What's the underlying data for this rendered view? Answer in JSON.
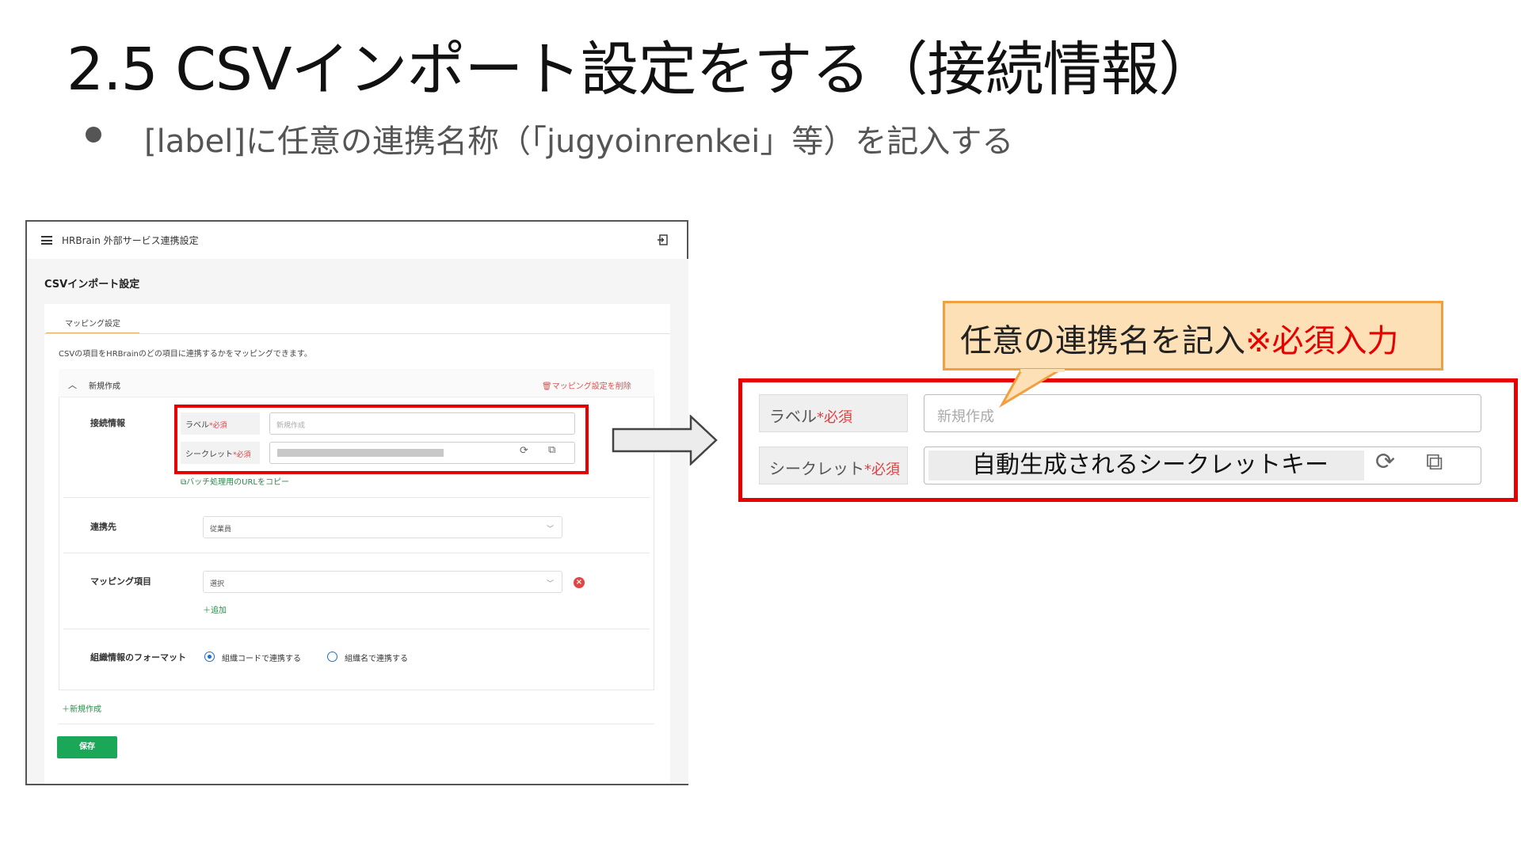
{
  "slide": {
    "title": "2.5 CSVインポート設定をする（接続情報）",
    "bullet": "[label]に任意の連携名称（「jugyoinrenkei」等）を記入する"
  },
  "app": {
    "title": "HRBrain 外部サービス連携設定",
    "page_heading": "CSVインポート設定",
    "tab": "マッピング設定",
    "description": "CSVの項目をHRBrainのどの項目に連携するかをマッピングできます。",
    "section_title": "新規作成",
    "delete_link": "マッピング設定を削除",
    "connection_label": "接続情報",
    "label_field": "ラベル",
    "required": "*必須",
    "label_placeholder": "新規作成",
    "secret_field": "シークレット",
    "copy_url_link": "バッチ処理用のURLをコピー",
    "destination_label": "連携先",
    "destination_value": "従業員",
    "mapping_label": "マッピング項目",
    "mapping_value": "選択",
    "add_label": "追加",
    "format_label": "組織情報のフォーマット",
    "radio_code": "組織コードで連携する",
    "radio_name": "組織名で連携する",
    "new_link": "新規作成",
    "save": "保存"
  },
  "zoom": {
    "label_field": "ラベル",
    "secret_field": "シークレット",
    "required": "*必須",
    "label_placeholder": "新規作成",
    "secret_value": "自動生成されるシークレットキー"
  },
  "callout": {
    "text": "任意の連携名を記入",
    "emphasis": "※必須入力"
  },
  "colors": {
    "highlight_red": "#e60000",
    "callout_fill": "#fde0b5",
    "callout_border": "#f0a040",
    "primary_green": "#1aa757"
  }
}
